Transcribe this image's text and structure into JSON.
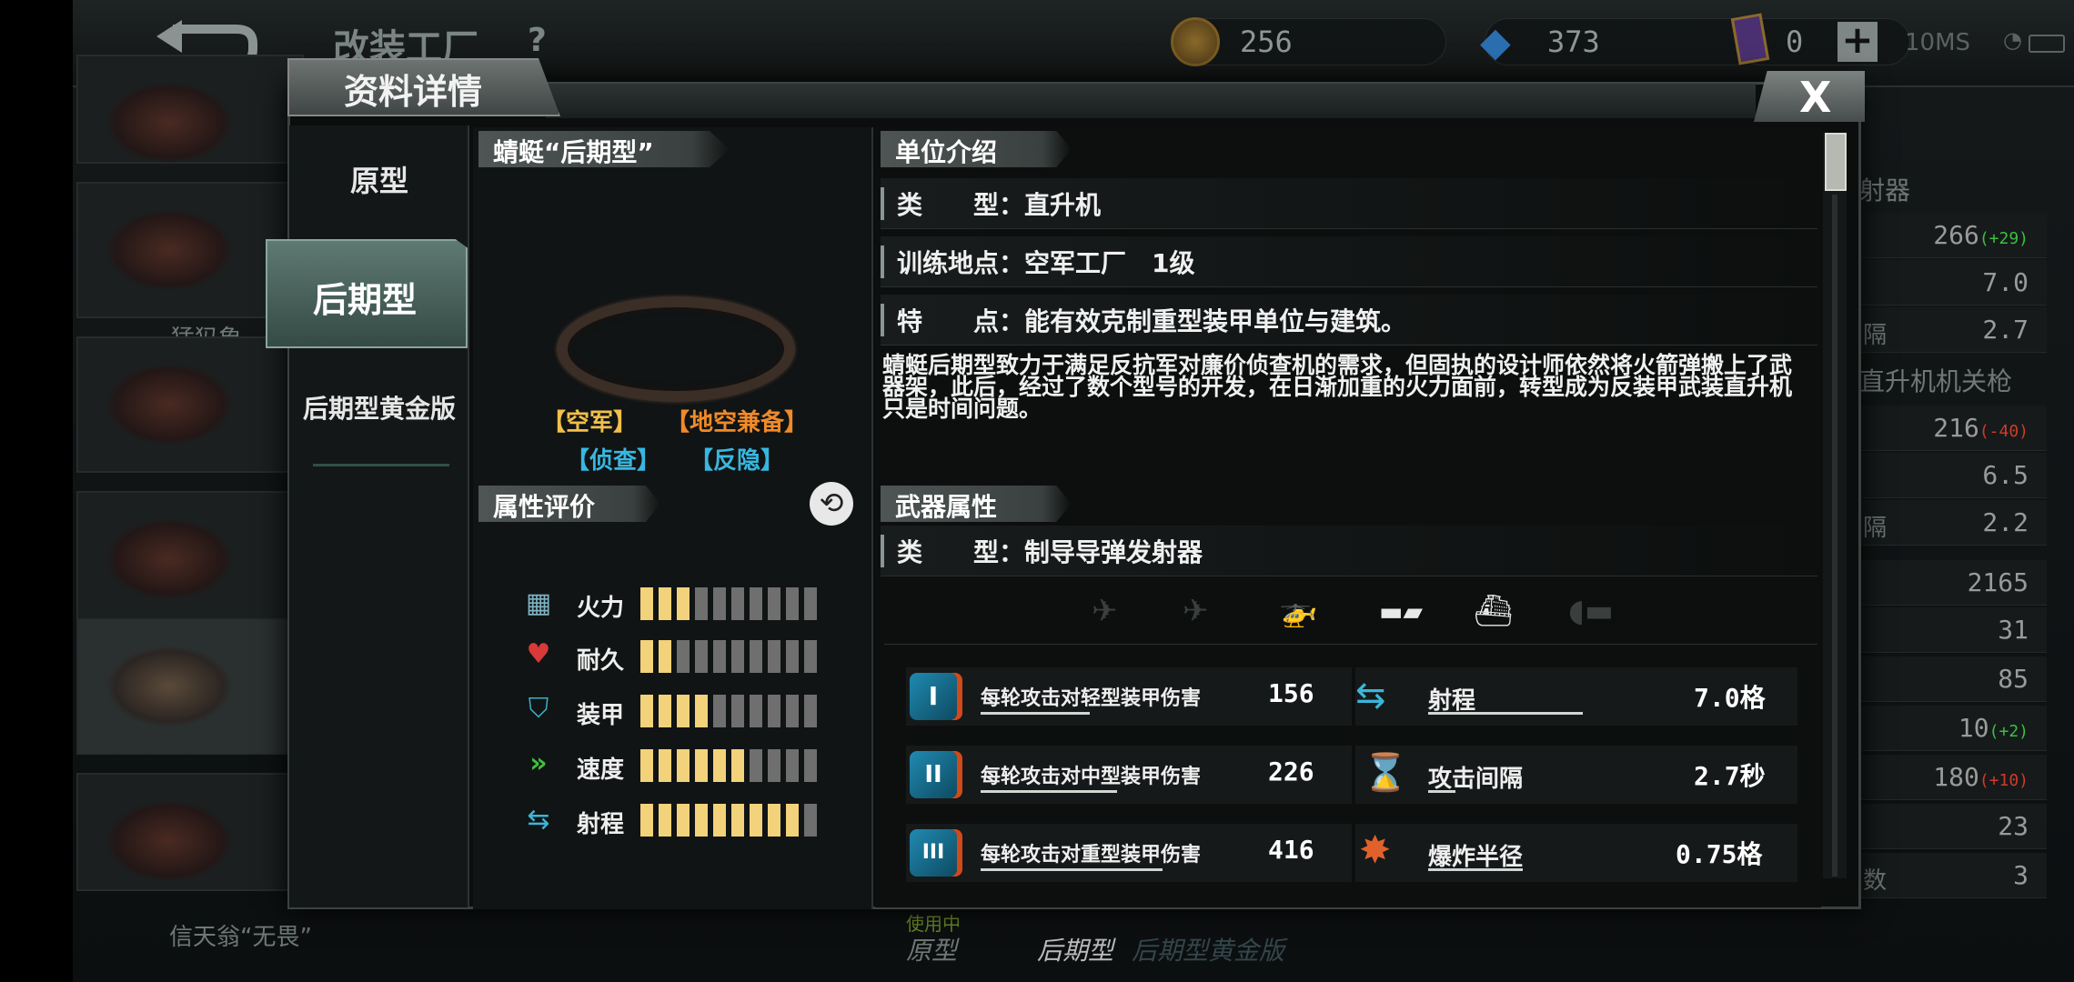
{
  "screen": {
    "title": "改装工厂",
    "help": "?"
  },
  "resources": [
    {
      "icon": "gold-coin-icon",
      "value": "256"
    },
    {
      "icon": "diamond-icon",
      "value": "373"
    },
    {
      "icon": "card-icon",
      "value": "0"
    }
  ],
  "topbar": {
    "add": "+",
    "network": "10MS"
  },
  "background_units": {
    "left_names": [
      "猛犸象",
      "信天翁“无畏”"
    ]
  },
  "background_stats": {
    "weapon1_title": "射器",
    "weapon2_title": "直升机机关枪",
    "rows": [
      {
        "label": "",
        "value": "266",
        "delta": "(+29)",
        "delta_color": "#39c141"
      },
      {
        "label": "",
        "value": "7.0",
        "delta": ""
      },
      {
        "label": "隔",
        "value": "2.7",
        "delta": ""
      },
      {
        "label": "",
        "value": "216",
        "delta": "(-40)",
        "delta_color": "#d13a2a"
      },
      {
        "label": "",
        "value": "6.5",
        "delta": ""
      },
      {
        "label": "隔",
        "value": "2.2",
        "delta": ""
      },
      {
        "label": "",
        "value": "2165",
        "delta": ""
      },
      {
        "label": "",
        "value": "31",
        "delta": ""
      },
      {
        "label": "",
        "value": "85",
        "delta": ""
      },
      {
        "label": "",
        "value": "10",
        "delta": "(+2)",
        "delta_color": "#39c141"
      },
      {
        "label": "",
        "value": "180",
        "delta": "(+10)",
        "delta_color": "#d13a2a"
      },
      {
        "label": "",
        "value": "23",
        "delta": ""
      },
      {
        "label": "数",
        "value": "3",
        "delta": ""
      }
    ]
  },
  "modal": {
    "title": "资料详情",
    "close": "X",
    "variants": [
      "原型",
      "后期型",
      "后期型黄金版"
    ],
    "active_variant": 1,
    "unit_name": "蜻蜓“后期型”",
    "tags": [
      {
        "text": "【空军】",
        "color": "#f1c04a"
      },
      {
        "text": "【地空兼备】",
        "color": "#f08a2a"
      },
      {
        "text": "【侦查】",
        "color": "#38b7e0"
      },
      {
        "text": "【反隐】",
        "color": "#38b7e0"
      }
    ],
    "attr_title": "属性评价",
    "attributes": [
      {
        "label": "火力",
        "icon": "firepower-icon",
        "level": 3,
        "max": 10
      },
      {
        "label": "耐久",
        "icon": "heart-icon",
        "level": 2,
        "max": 10
      },
      {
        "label": "装甲",
        "icon": "armor-shield-icon",
        "level": 4,
        "max": 10
      },
      {
        "label": "速度",
        "icon": "speed-chevron-icon",
        "level": 6,
        "max": 10
      },
      {
        "label": "射程",
        "icon": "range-arrows-icon",
        "level": 9,
        "max": 10
      }
    ],
    "intro_title": "单位介绍",
    "intro_lines": [
      "类　　型：直升机",
      "训练地点：空军工厂　1级",
      "特　　点：能有效克制重型装甲单位与建筑。"
    ],
    "description": "蜻蜓后期型致力于满足反抗军对廉价侦查机的需求，但固执的设计师依然将火箭弹搬上了武器架，此后，经过了数个型号的开发，在日渐加重的火力面前，转型成为反装甲武装直升机只是时间问题。",
    "weapon_title": "武器属性",
    "weapon_type": "类　　型：制导导弹发射器",
    "targets": [
      {
        "icon": "fighter-jet-icon",
        "active": false
      },
      {
        "icon": "bomber-plane-icon",
        "active": false
      },
      {
        "icon": "helicopter-icon",
        "active": true
      },
      {
        "icon": "tank-icon",
        "active": true
      },
      {
        "icon": "ship-icon",
        "active": true
      },
      {
        "icon": "submarine-icon",
        "active": false
      }
    ],
    "damage_stats": [
      {
        "label": "每轮攻击对轻型装甲伤害",
        "value": "156",
        "badge": "I"
      },
      {
        "label": "每轮攻击对中型装甲伤害",
        "value": "226",
        "badge": "II"
      },
      {
        "label": "每轮攻击对重型装甲伤害",
        "value": "416",
        "badge": "III"
      }
    ],
    "other_stats": [
      {
        "label": "射程",
        "value": "7.0格",
        "icon": "range-arrows-icon"
      },
      {
        "label": "攻击间隔",
        "value": "2.7秒",
        "icon": "hourglass-icon"
      },
      {
        "label": "爆炸半径",
        "value": "0.75格",
        "icon": "explosion-icon"
      }
    ]
  },
  "bottom_tabs": {
    "in_use": "使用中",
    "items": [
      "原型",
      "后期型",
      "后期型黄金版"
    ]
  },
  "colors": {
    "accent_yellow": "#f2d27a",
    "tab_green": "#5e7a72",
    "cyan": "#38b7e0"
  }
}
